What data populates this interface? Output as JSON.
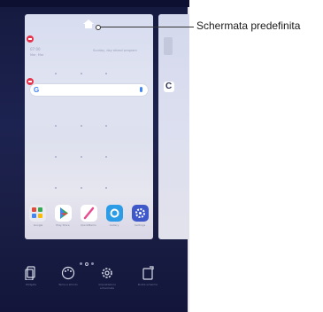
{
  "callout": {
    "label": "Schermata predefinita"
  },
  "widget": {
    "time": "07:00",
    "date": "Mar, Mar",
    "weather": "Sunday, day ahead program"
  },
  "search": {
    "logo": "G"
  },
  "dock": [
    {
      "name": "Google",
      "icon": "google-folder-icon",
      "color": "#e8eaf0"
    },
    {
      "name": "Play Store",
      "icon": "play-store-icon",
      "color": "#ffffff"
    },
    {
      "name": "QuickMemo",
      "icon": "quickmemo-icon",
      "color": "#e94b8f"
    },
    {
      "name": "Gallery",
      "icon": "gallery-icon",
      "color": "#2c9ce6"
    },
    {
      "name": "Settings",
      "icon": "settings-icon",
      "color": "#3f58c9"
    }
  ],
  "bottom_bar": [
    {
      "label": "Widgets",
      "icon": "widgets-icon"
    },
    {
      "label": "Tema e sfondo",
      "icon": "theme-palette-icon"
    },
    {
      "label": "Impostazioni schermata",
      "icon": "settings-gear-icon"
    },
    {
      "label": "Ruota schermo",
      "icon": "rotate-icon"
    }
  ],
  "colors": {
    "accent": "#4285f4",
    "remove": "#e5344c",
    "background": "#1a1e45"
  }
}
